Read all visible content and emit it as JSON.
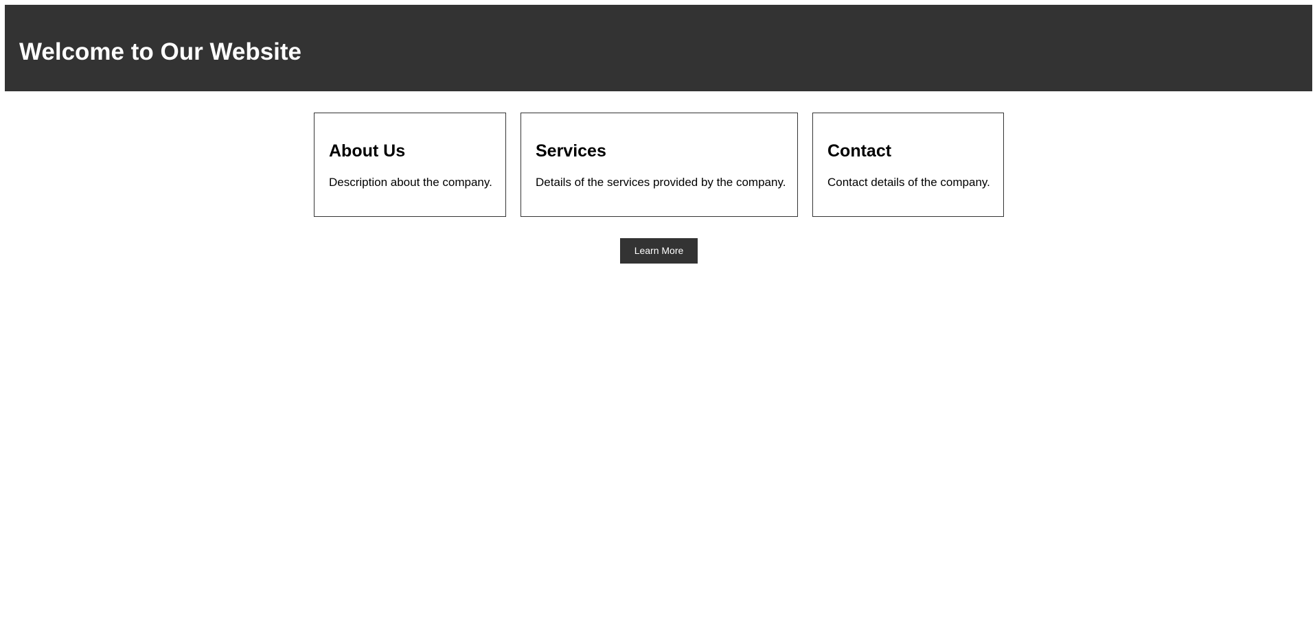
{
  "header": {
    "title": "Welcome to Our Website",
    "background_color": "#333333",
    "text_color": "#ffffff"
  },
  "cards": [
    {
      "heading": "About Us",
      "text": "Description about the company."
    },
    {
      "heading": "Services",
      "text": "Details of the services provided by the company."
    },
    {
      "heading": "Contact",
      "text": "Contact details of the company."
    }
  ],
  "cta": {
    "label": "Learn More",
    "background_color": "#333333",
    "text_color": "#ffffff"
  }
}
